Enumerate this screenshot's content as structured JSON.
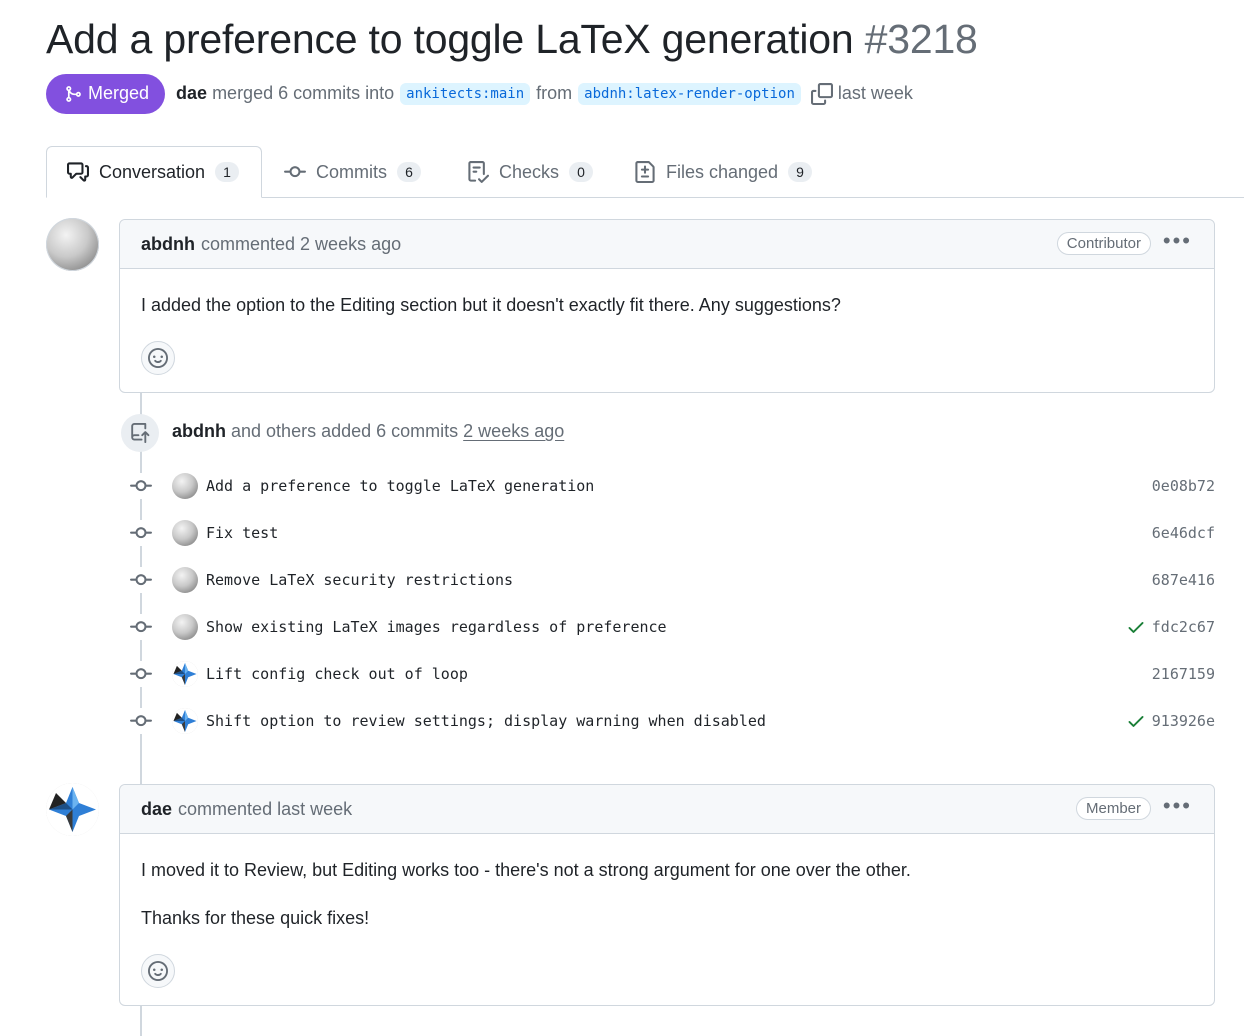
{
  "pr": {
    "title": "Add a preference to toggle LaTeX generation",
    "number": "#3218",
    "state_label": "Merged",
    "author": "dae",
    "merged_text": "merged 6 commits into",
    "base_branch": "ankitects:main",
    "from_text": "from",
    "head_branch": "abdnh:latex-render-option",
    "time": "last week"
  },
  "tabs": [
    {
      "label": "Conversation",
      "count": "1",
      "icon": "comment-discussion-icon"
    },
    {
      "label": "Commits",
      "count": "6",
      "icon": "git-commit-icon"
    },
    {
      "label": "Checks",
      "count": "0",
      "icon": "checklist-icon"
    },
    {
      "label": "Files changed",
      "count": "9",
      "icon": "file-diff-icon"
    }
  ],
  "comments": [
    {
      "author": "abdnh",
      "action": "commented 2 weeks ago",
      "role": "Contributor",
      "body": [
        "I added the option to the Editing section but it doesn't exactly fit there. Any suggestions?"
      ]
    },
    {
      "author": "dae",
      "action": "commented last week",
      "role": "Member",
      "body": [
        "I moved it to Review, but Editing works too - there's not a strong argument for one over the other.",
        "Thanks for these quick fixes!"
      ]
    }
  ],
  "commit_group": {
    "author": "abdnh",
    "text": "and others added 6 commits",
    "time": "2 weeks ago",
    "commits": [
      {
        "message": "Add a preference to toggle LaTeX generation",
        "sha": "0e08b72",
        "checked": false,
        "avatar": "grey"
      },
      {
        "message": "Fix test",
        "sha": "6e46dcf",
        "checked": false,
        "avatar": "grey"
      },
      {
        "message": "Remove LaTeX security restrictions",
        "sha": "687e416",
        "checked": false,
        "avatar": "grey"
      },
      {
        "message": "Show existing LaTeX images regardless of preference",
        "sha": "fdc2c67",
        "checked": true,
        "avatar": "grey"
      },
      {
        "message": "Lift config check out of loop",
        "sha": "2167159",
        "checked": false,
        "avatar": "star"
      },
      {
        "message": "Shift option to review settings; display warning when disabled",
        "sha": "913926e",
        "checked": true,
        "avatar": "star"
      }
    ]
  },
  "colors": {
    "merged": "#8250df",
    "branch_bg": "#ddf4ff",
    "branch_fg": "#0969da",
    "check": "#1a7f37",
    "border": "#d0d7de",
    "muted": "#656d76"
  }
}
